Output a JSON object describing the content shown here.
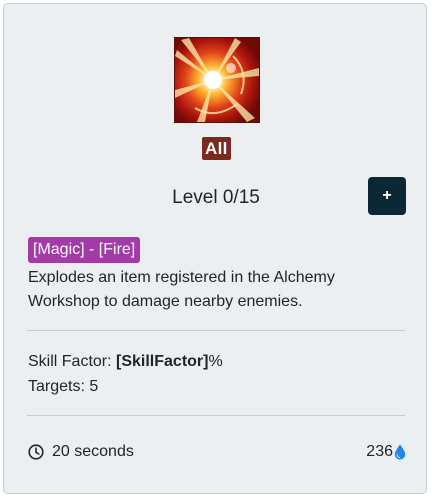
{
  "skill": {
    "icon_name": "fire-explosion-icon",
    "badge": "All",
    "level_label": "Level 0/15",
    "add_label": "+",
    "type_tag": "[Magic] - [Fire]",
    "description": "Explodes an item registered in the Alchemy Workshop to damage nearby enemies.",
    "stats": {
      "skill_factor_label": "Skill Factor: ",
      "skill_factor_value": "[SkillFactor]",
      "skill_factor_unit": "%",
      "targets": "Targets: 5"
    },
    "cooldown": "20 seconds",
    "cost": "236",
    "cost_icon": "water-drop-icon"
  },
  "colors": {
    "card_bg": "#eceff1",
    "badge_bg": "#7b2a1f",
    "tag_bg": "#a23ba8",
    "button_bg": "#0b2733",
    "drop": "#1e88e5"
  }
}
